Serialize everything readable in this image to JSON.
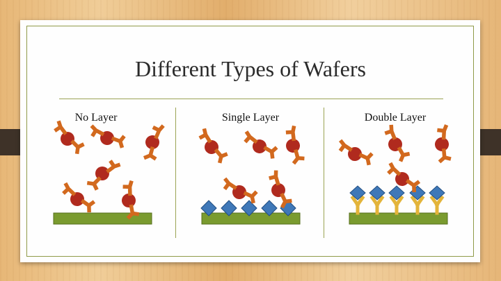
{
  "title": "Different Types of Wafers",
  "columns": [
    {
      "label": "No Layer"
    },
    {
      "label": "Single Layer"
    },
    {
      "label": "Double Layer"
    }
  ],
  "colors": {
    "slide_border": "#8f9a48",
    "divider": "#9aa353",
    "wafer": "#7a9b2f",
    "antibody": "#d2691e",
    "antigen": "#b02a1e",
    "diamond": "#3f78b8",
    "linker": "#e3b43a",
    "tab": "#3e3228"
  }
}
